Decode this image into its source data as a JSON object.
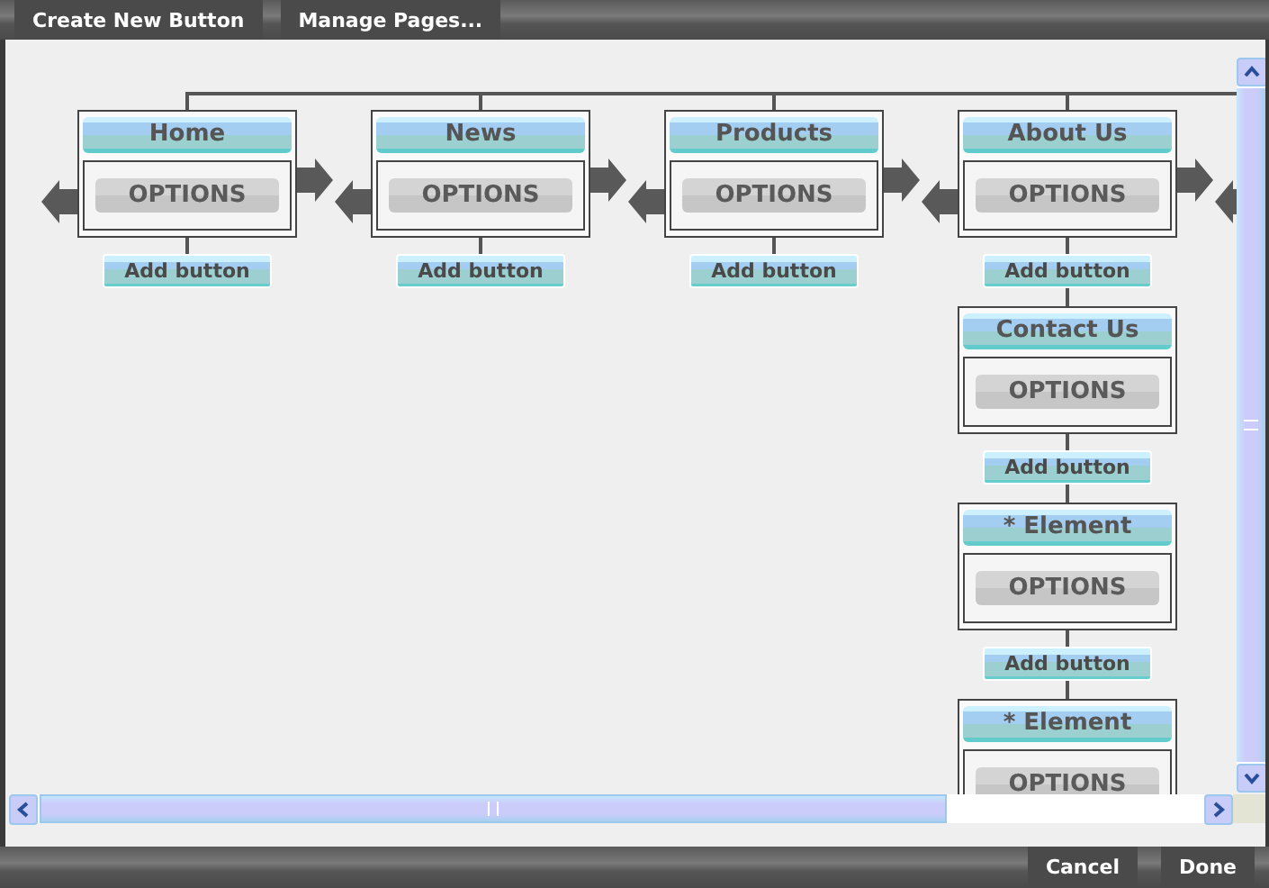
{
  "toolbar": {
    "buttons": [
      "Create New Button",
      "Manage Pages..."
    ]
  },
  "pages": [
    {
      "title": "Home",
      "options": "OPTIONS",
      "add_button": "Add button"
    },
    {
      "title": "News",
      "options": "OPTIONS",
      "add_button": "Add button"
    },
    {
      "title": "Products",
      "options": "OPTIONS",
      "add_button": "Add button"
    },
    {
      "title": "About Us",
      "options": "OPTIONS",
      "add_button": "Add button",
      "children": [
        {
          "title": "Contact Us",
          "options": "OPTIONS",
          "add_button": "Add button"
        },
        {
          "title": "* Element",
          "options": "OPTIONS",
          "add_button": "Add button"
        },
        {
          "title": "* Element",
          "options": "OPTIONS"
        }
      ]
    }
  ],
  "footer": {
    "buttons": [
      "Cancel",
      "Done"
    ]
  }
}
